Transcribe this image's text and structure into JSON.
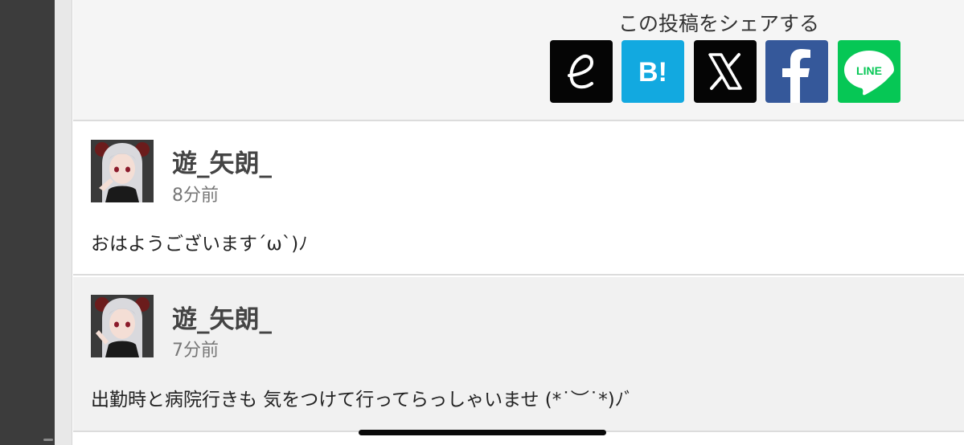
{
  "share": {
    "title": "この投稿をシェアする",
    "buttons": [
      {
        "name": "excite",
        "icon": "excite-e-icon",
        "color": "#050505"
      },
      {
        "name": "hatena-bookmark",
        "icon": "hatena-bookmark-icon",
        "label": "B!",
        "color": "#12a9e0"
      },
      {
        "name": "x",
        "icon": "x-logo-icon",
        "color": "#050505"
      },
      {
        "name": "facebook",
        "icon": "facebook-icon",
        "color": "#35589a"
      },
      {
        "name": "line",
        "icon": "line-icon",
        "label": "LINE",
        "color": "#06c755"
      }
    ]
  },
  "comments": [
    {
      "username": "遊_矢朗_",
      "time": "8分前",
      "text": "おはようございます´ω`)ﾉ",
      "avatar": "anime-girl-avatar"
    },
    {
      "username": "遊_矢朗_",
      "time": "7分前",
      "text": "出勤時と病院行きも 気をつけて行ってらっしゃいませ (*˙︶˙*)ﾉﾞ",
      "avatar": "anime-girl-avatar"
    }
  ]
}
